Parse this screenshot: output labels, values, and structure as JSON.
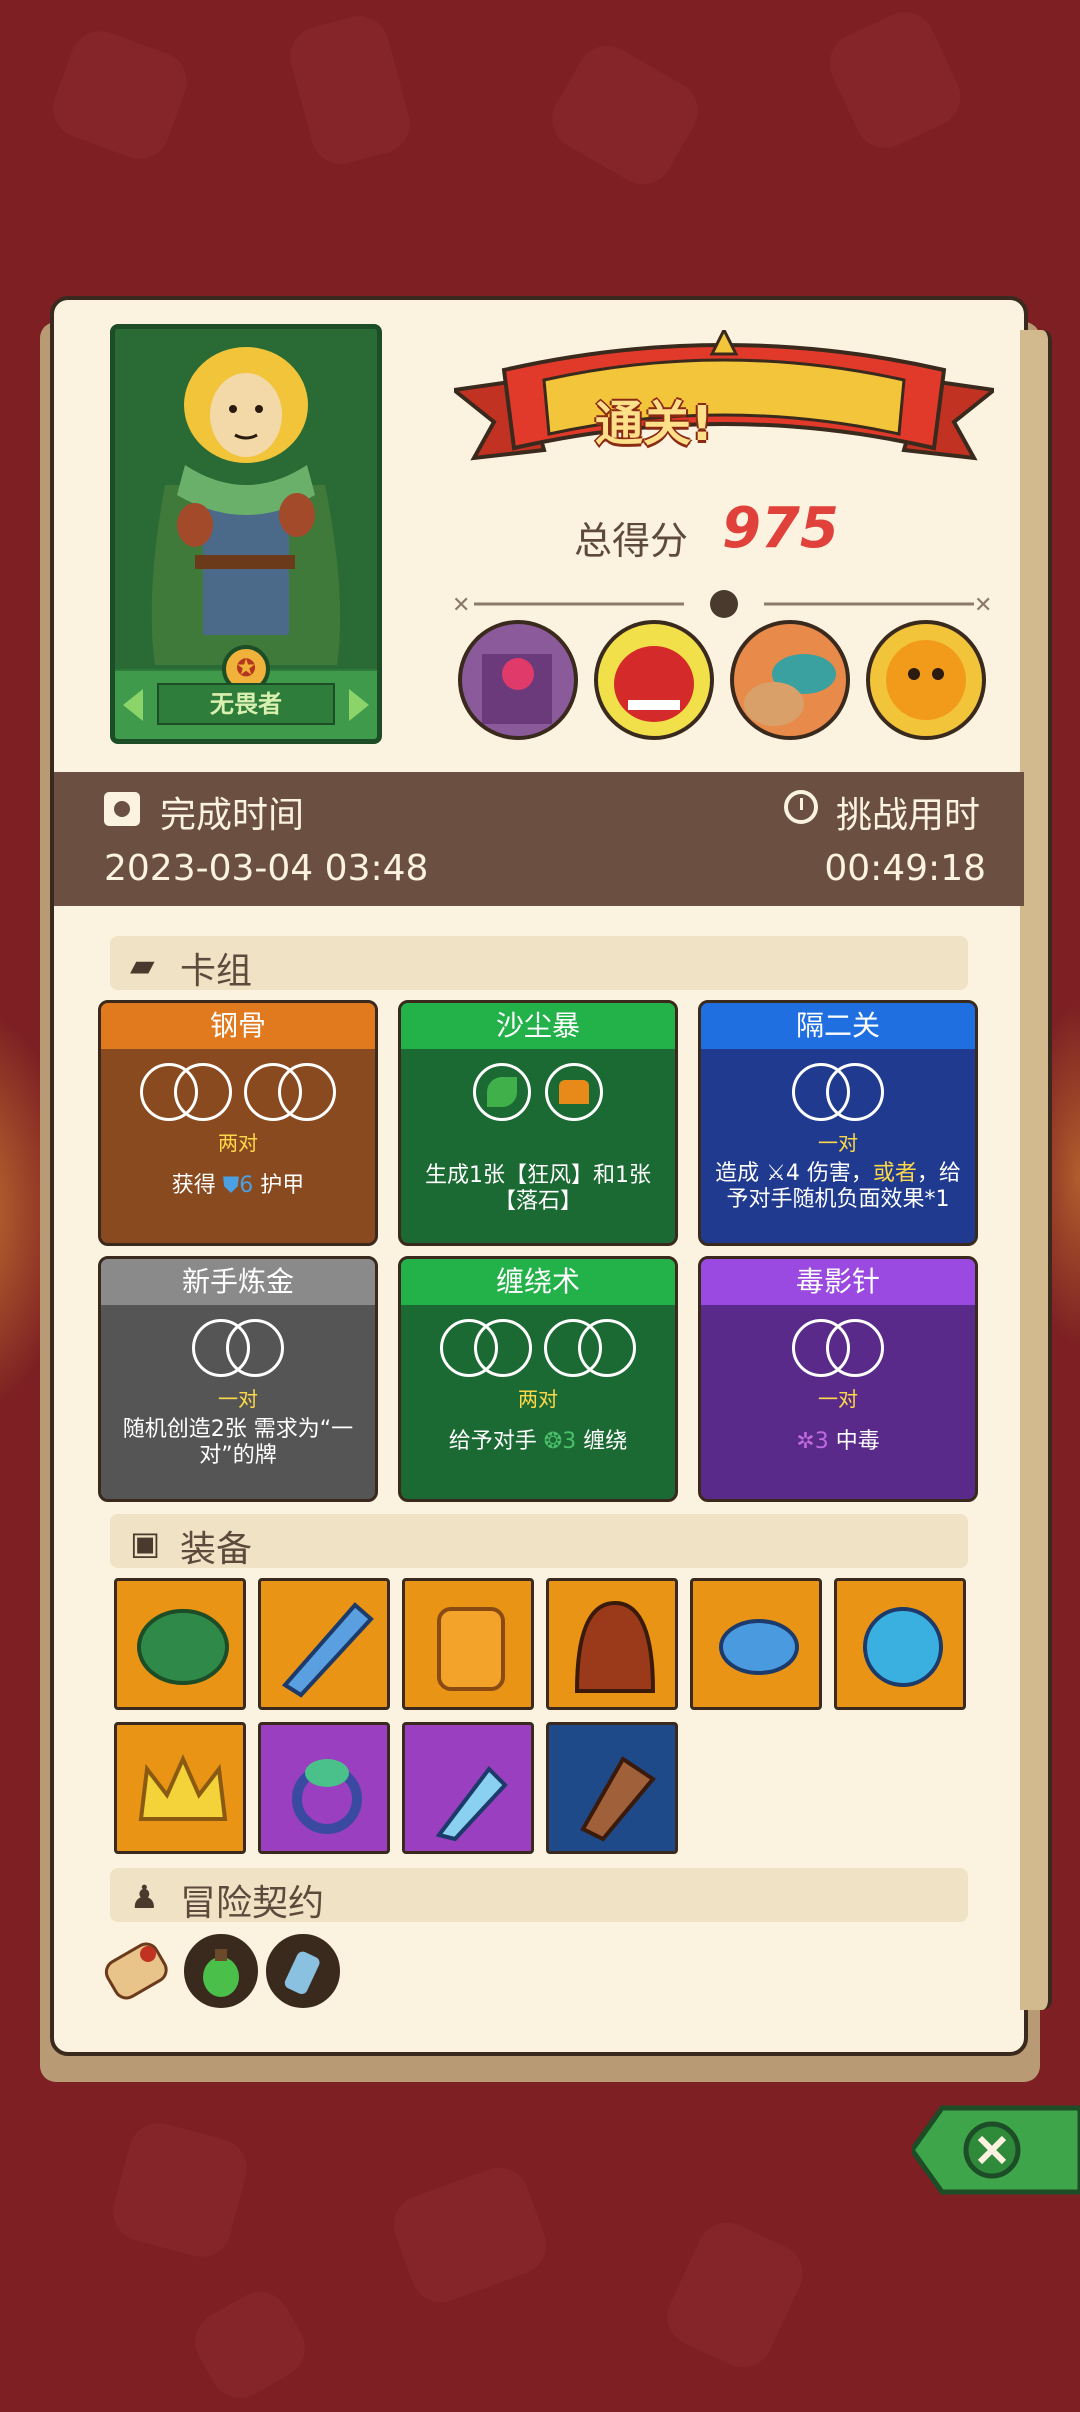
{
  "hero": {
    "name": "无畏者"
  },
  "result": {
    "banner": "通关!",
    "score_label": "总得分",
    "score": "975"
  },
  "bosses": [
    {
      "icon": "stone-golem-boss-icon"
    },
    {
      "icon": "red-demon-boss-icon"
    },
    {
      "icon": "fish-beast-boss-icon"
    },
    {
      "icon": "sun-pumpkin-boss-icon"
    }
  ],
  "timing": {
    "completion_label": "完成时间",
    "completion_value": "2023-03-04 03:48",
    "duration_label": "挑战用时",
    "duration_value": "00:49:18"
  },
  "sections": {
    "deck": "卡组",
    "equipment": "装备",
    "contract": "冒险契约"
  },
  "cards": [
    {
      "title": "钢骨",
      "sub": "两对",
      "desc_pre": "获得 ",
      "desc_num": "6",
      "desc_post": " 护甲",
      "colors": {
        "head": "#e1791f",
        "body": "#8a4a1f"
      }
    },
    {
      "title": "沙尘暴",
      "sub": "",
      "desc": "生成1张【狂风】和1张【落石】",
      "colors": {
        "head": "#23b14a",
        "body": "#1c6a33"
      }
    },
    {
      "title": "隔二关",
      "sub": "一对",
      "desc_pre": "造成 ",
      "desc_num": "4",
      "desc_mid": " 伤害，",
      "desc_hl": "或者",
      "desc_post": "，给予对手随机负面效果*1",
      "colors": {
        "head": "#1f6fe0",
        "body": "#1f3a8f"
      }
    },
    {
      "title": "新手炼金",
      "sub": "一对",
      "desc": "随机创造2张 需求为“一对”的牌",
      "colors": {
        "head": "#8a8a8a",
        "body": "#555555"
      }
    },
    {
      "title": "缠绕术",
      "sub": "两对",
      "desc_pre": "给予对手 ",
      "desc_num": "3",
      "desc_post": " 缠绕",
      "colors": {
        "head": "#23b14a",
        "body": "#1c6a33"
      }
    },
    {
      "title": "毒影针",
      "sub": "一对",
      "desc_num": "3",
      "desc_post": " 中毒",
      "colors": {
        "head": "#9a4ae0",
        "body": "#5a2a8a"
      }
    }
  ],
  "equipment": [
    {
      "icon": "turtle-shell-icon",
      "color": "#ea9416"
    },
    {
      "icon": "saw-blade-icon",
      "color": "#ea9416"
    },
    {
      "icon": "sweater-icon",
      "color": "#ea9416"
    },
    {
      "icon": "hood-icon",
      "color": "#ea9416"
    },
    {
      "icon": "mushroom-icon",
      "color": "#ea9416"
    },
    {
      "icon": "orb-icon",
      "color": "#ea9416"
    },
    {
      "icon": "crown-icon",
      "color": "#ea9416"
    },
    {
      "icon": "leaf-ring-icon",
      "color": "#9a3fc0"
    },
    {
      "icon": "ice-dagger-icon",
      "color": "#9a3fc0"
    },
    {
      "icon": "horn-icon",
      "color": "#1e4a8a"
    }
  ],
  "contracts": [
    {
      "icon": "scroll-icon"
    },
    {
      "icon": "potion-icon"
    },
    {
      "icon": "bottle-icon"
    }
  ]
}
